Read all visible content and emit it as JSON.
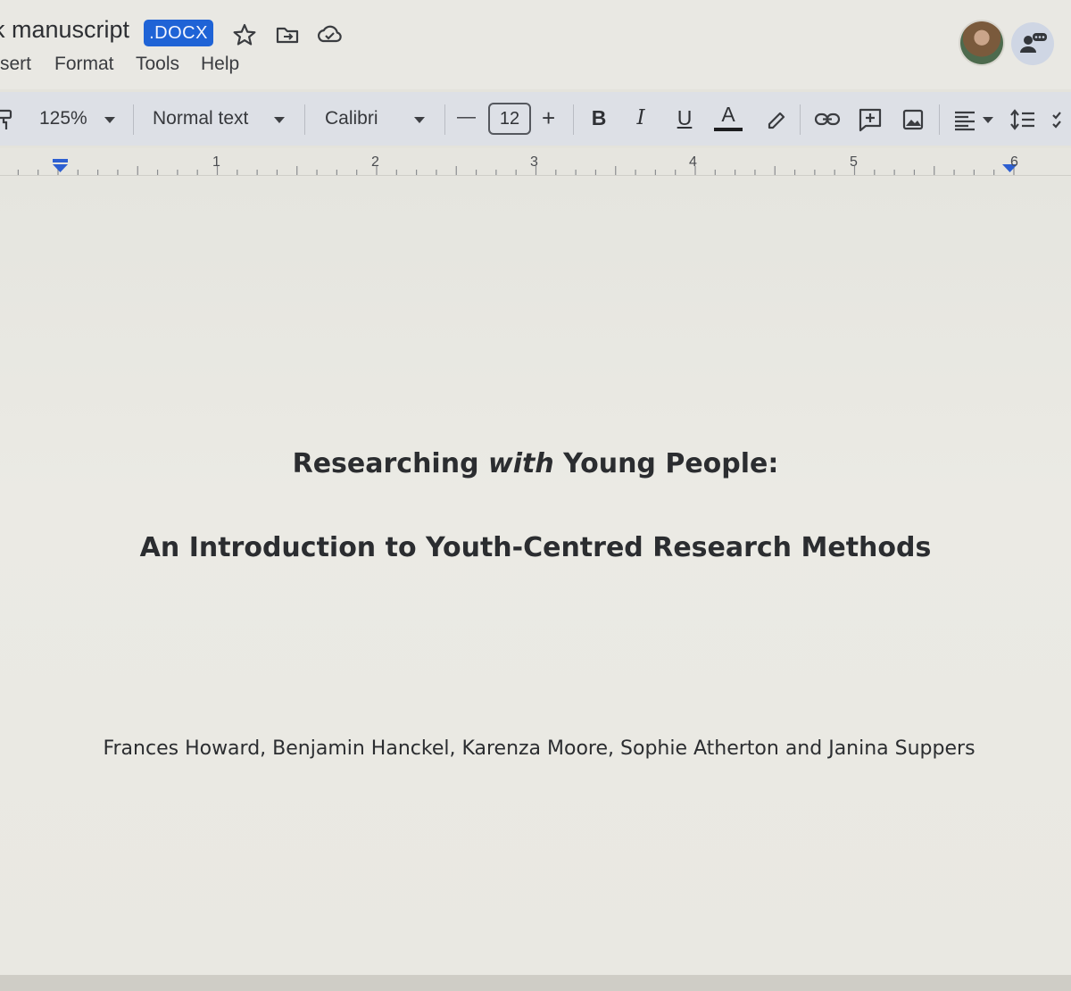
{
  "header": {
    "doc_title": "k manuscript",
    "file_badge": ".DOCX",
    "icons": [
      "star-icon",
      "move-to-folder-icon",
      "cloud-saved-icon",
      "account-avatar",
      "share-icon"
    ]
  },
  "menu": {
    "items": [
      "sert",
      "Format",
      "Tools",
      "Help"
    ]
  },
  "toolbar": {
    "zoom": "125%",
    "style": "Normal text",
    "font": "Calibri",
    "font_size": "12",
    "minus": "—",
    "plus": "+",
    "bold": "B",
    "italic": "I",
    "underline": "U",
    "text_color": "A",
    "icons": [
      "paint-format-icon",
      "highlight-icon",
      "link-icon",
      "add-comment-icon",
      "image-icon",
      "align-left-icon",
      "line-spacing-icon",
      "checklist-icon"
    ]
  },
  "ruler": {
    "numbers": [
      "1",
      "2",
      "3",
      "4",
      "5",
      "6"
    ]
  },
  "document": {
    "title_part1": "Researching ",
    "title_italic": "with",
    "title_part2": " Young People:",
    "subtitle": "An Introduction to Youth-Centred Research Methods",
    "authors": "Frances Howard, Benjamin Hanckel, Karenza Moore, Sophie Atherton and Janina Suppers"
  },
  "colors": {
    "badge": "#1f63d6",
    "toolbar": "#dde0e6",
    "page": "#e9e8e2",
    "indent_marker": "#2d5fd1"
  }
}
